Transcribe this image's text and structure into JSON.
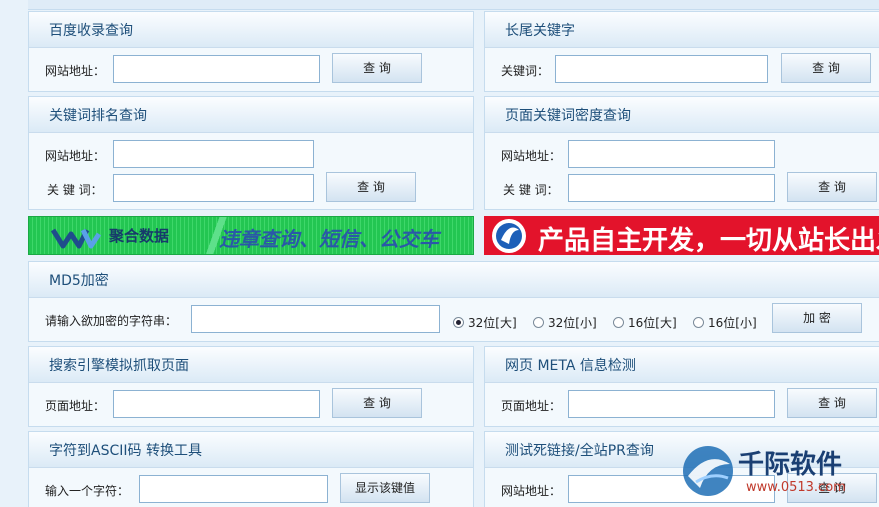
{
  "baidu": {
    "title": "百度收录查询",
    "url_label": "网站地址：",
    "query_btn": "查 询"
  },
  "longtail": {
    "title": "长尾关键字",
    "kw_label": "关键词：",
    "query_btn": "查 询"
  },
  "rank": {
    "title": "关键词排名查询",
    "url_label": "网站地址：",
    "kw_label": "关 键 词：",
    "query_btn": "查 询"
  },
  "density": {
    "title": "页面关键词密度查询",
    "url_label": "网站地址：",
    "kw_label": "关 键 词：",
    "query_btn": "查 询"
  },
  "banner_left": {
    "logo_text": "聚合数据",
    "slogan": "违章查询、短信、公交车",
    "color": "#1fc34e"
  },
  "banner_right": {
    "text": "产品自主开发，一切从站长出发",
    "color": "#e3132b"
  },
  "md5": {
    "title": "MD5加密",
    "input_label": "请输入欲加密的字符串：",
    "options": [
      "32位[大]",
      "32位[小]",
      "16位[大]",
      "16位[小]"
    ],
    "selected": "32位[大]",
    "encrypt_btn": "加 密"
  },
  "spider": {
    "title": "搜索引擎模拟抓取页面",
    "page_label": "页面地址：",
    "query_btn": "查 询"
  },
  "meta": {
    "title": "网页 META 信息检测",
    "page_label": "页面地址：",
    "query_btn": "查 询"
  },
  "ascii": {
    "title": "字符到ASCII码 转换工具",
    "char_label": "输入一个字符：",
    "show_btn": "显示该键值"
  },
  "deadlink": {
    "title": "测试死链接/全站PR查询",
    "url_label": "网站地址：",
    "query_btn": "查 询"
  },
  "watermark": {
    "brand": "千际软件",
    "url": "www.0513.com"
  }
}
